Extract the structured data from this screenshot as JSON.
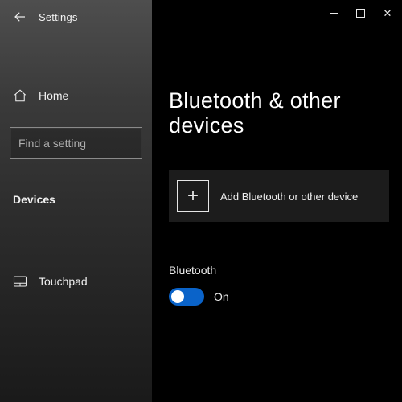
{
  "header": {
    "title": "Settings"
  },
  "sidebar": {
    "home_label": "Home",
    "search_placeholder": "Find a setting",
    "section_label": "Devices",
    "items": [
      {
        "label": "Touchpad"
      }
    ]
  },
  "main": {
    "page_title": "Bluetooth & other devices",
    "add_device_label": "Add Bluetooth or other device",
    "bluetooth_label": "Bluetooth",
    "toggle_state": "On"
  },
  "colors": {
    "accent": "#0a63c9"
  }
}
